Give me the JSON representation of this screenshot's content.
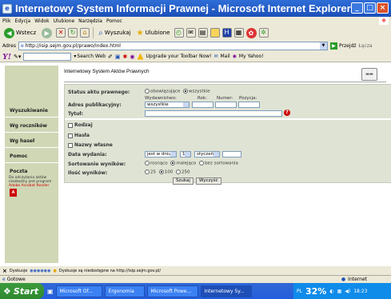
{
  "window": {
    "title": "Internetowy System Informacji Prawnej - Microsoft Internet Explorer"
  },
  "menubar": [
    "Plik",
    "Edycja",
    "Widok",
    "Ulubione",
    "Narzędzia",
    "Pomoc"
  ],
  "toolbar": {
    "back_label": "Wstecz",
    "search_label": "Wyszukaj",
    "favorites_label": "Ulubione"
  },
  "addressbar": {
    "label": "Adres",
    "url": "http://isip.sejm.gov.pl/prawo/index.html",
    "go_label": "Przejdź",
    "links_label": "Łącza"
  },
  "yahoobar": {
    "search_web": "Search Web",
    "upgrade_text": "Upgrade your Toolbar Now!",
    "mail": "Mail",
    "my_yahoo": "My Yahoo!"
  },
  "sidebar": {
    "items": [
      "Wyszukiwanie",
      "Wg roczników",
      "Wg haseł",
      "Pomoc",
      "Poczta"
    ],
    "note": "Do odczytania aktów niezbędny jest program",
    "note_red": "Adobe Acrobat Reader"
  },
  "page": {
    "header_title": "Internetowy System Aktów Prawnych"
  },
  "form": {
    "status_label": "Status aktu prawnego:",
    "status_options": [
      "obowiązujące",
      "wszystkie"
    ],
    "status_selected": "wszystkie",
    "address_label": "Adres publikacyjny:",
    "publisher_label": "Wydawnictwo:",
    "publisher_value": "wszystkie",
    "year_label": "Rok:",
    "number_label": "Numer:",
    "position_label": "Pozycja:",
    "title_label": "Tytuł:",
    "check_rodzaj": "Rodzaj",
    "check_hasla": "Hasła",
    "check_nazwy": "Nazwy własne",
    "date_label": "Data wydania:",
    "date_mode": "jest w dniu",
    "date_day": "1",
    "date_month": "styczeń",
    "sort_label": "Sortowanie wyników:",
    "sort_options": [
      "rosnąco",
      "malejąco",
      "bez sortowania"
    ],
    "sort_selected": "malejąco",
    "count_label": "Ilość wyników:",
    "count_options": [
      "25",
      "100",
      "250"
    ],
    "count_selected": "100",
    "search_button": "Szukaj",
    "clear_button": "Wyczyść"
  },
  "findbar": {
    "close": "×",
    "label": "Dyskusje",
    "message": "Dyskusje są niedostępne na http://isip.sejm.gov.pl/"
  },
  "status": {
    "text": "Gotowe",
    "zone": "Internet"
  },
  "taskbar": {
    "start": "Start",
    "tasks": [
      "Microsoft Of...",
      "Ergonomia",
      "Microsoft Powe...",
      "Internetowy Sy..."
    ],
    "battery": "32%",
    "clock": "18:23"
  }
}
